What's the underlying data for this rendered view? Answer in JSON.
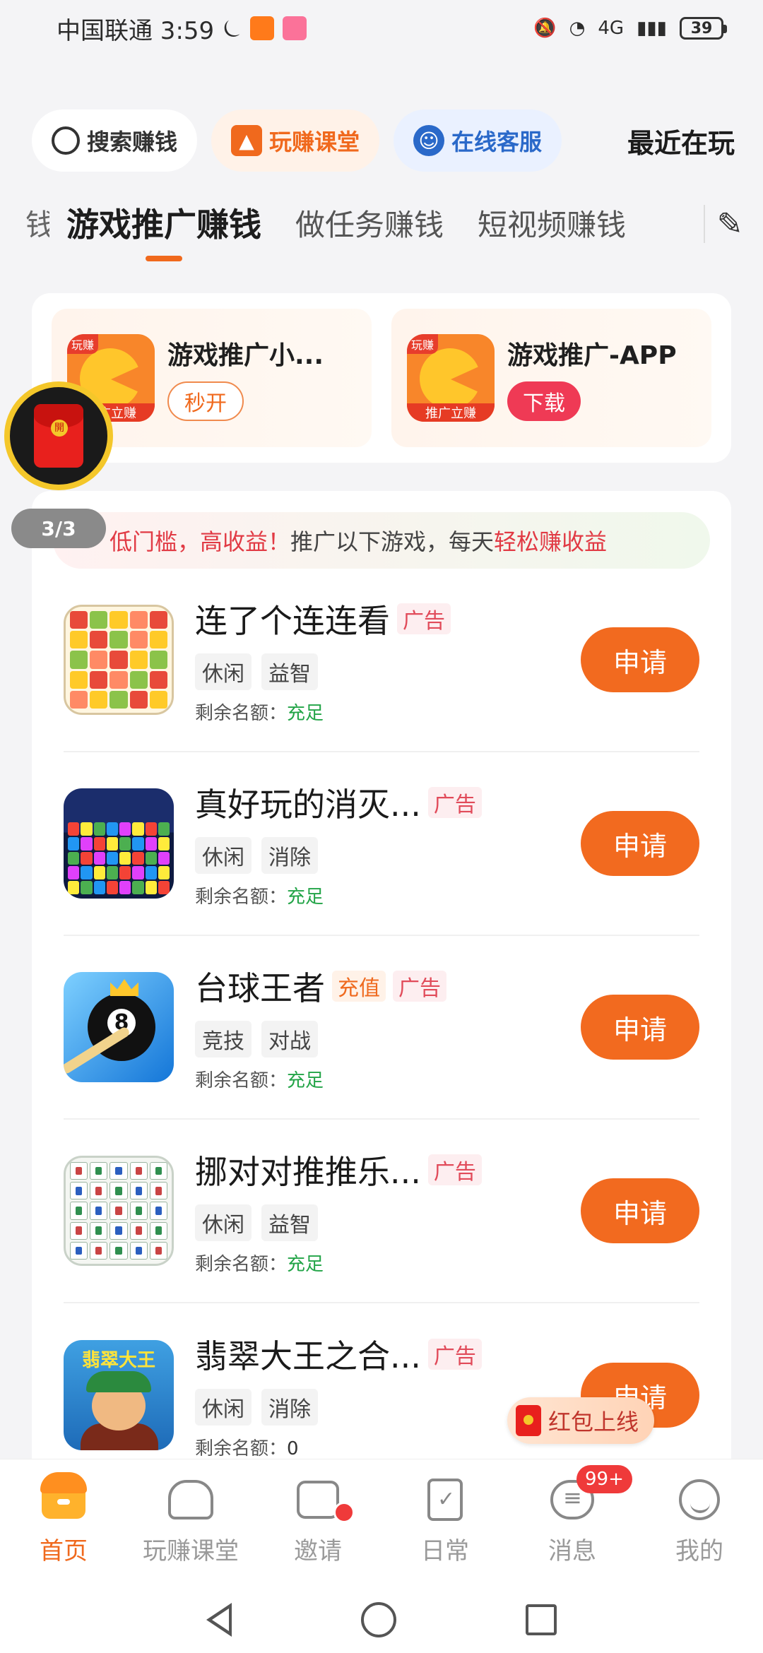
{
  "status_bar": {
    "carrier_time": "中国联通 3:59",
    "network": "4G",
    "battery": "39",
    "icons": [
      "alarm-off-icon",
      "taobao-app-icon",
      "bilibili-app-icon",
      "mute-icon",
      "wifi-icon",
      "signal-icon",
      "battery-icon"
    ]
  },
  "top_chips": {
    "search": "搜索赚钱",
    "course": "玩赚课堂",
    "service": "在线客服",
    "recent": "最近在玩"
  },
  "tabs": {
    "cut_prev": "钱",
    "items": [
      "游戏推广赚钱",
      "做任务赚钱",
      "短视频赚钱"
    ],
    "active_index": 0
  },
  "promo": {
    "items": [
      {
        "title": "游戏推广小...",
        "button": "秒开",
        "icon_badge": "玩赚",
        "icon_ribbon": "推广立赚"
      },
      {
        "title": "游戏推广-APP",
        "button": "下载",
        "icon_badge": "玩赚",
        "icon_ribbon": "推广立赚"
      }
    ]
  },
  "floating_packet": {
    "label": "開",
    "pager": "3/3"
  },
  "slogan": {
    "part1": "低门槛，高收益！",
    "part2": "推广以下游戏，每天",
    "part3": "轻松赚收益"
  },
  "games": [
    {
      "name": "连了个连连看",
      "extra": "",
      "ad": "广告",
      "tags": [
        "休闲",
        "益智"
      ],
      "quota_label": "剩余名额：",
      "quota": "充足",
      "button": "申请"
    },
    {
      "name": "真好玩的消灭...",
      "extra": "",
      "ad": "广告",
      "tags": [
        "休闲",
        "消除"
      ],
      "quota_label": "剩余名额：",
      "quota": "充足",
      "button": "申请"
    },
    {
      "name": "台球王者",
      "extra": "充值",
      "ad": "广告",
      "tags": [
        "竞技",
        "对战"
      ],
      "quota_label": "剩余名额：",
      "quota": "充足",
      "button": "申请"
    },
    {
      "name": "挪对对推推乐...",
      "extra": "",
      "ad": "广告",
      "tags": [
        "休闲",
        "益智"
      ],
      "quota_label": "剩余名额：",
      "quota": "充足",
      "button": "申请"
    },
    {
      "name": "翡翠大王之合...",
      "extra": "",
      "ad": "广告",
      "tags": [
        "休闲",
        "消除"
      ],
      "quota_label": "剩余名额：",
      "quota": "0",
      "button": "申请",
      "icon_text": "翡翠大王"
    }
  ],
  "red_packet_notice": "红包上线",
  "bottom_nav": {
    "items": [
      "首页",
      "玩赚课堂",
      "邀请",
      "日常",
      "消息",
      "我的"
    ],
    "active_index": 0,
    "message_badge": "99+"
  }
}
